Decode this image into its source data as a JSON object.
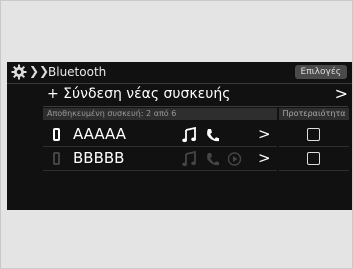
{
  "header": {
    "title": "Bluetooth",
    "options_label": "Επιλογές"
  },
  "add_device": {
    "label": "+ Σύνδεση νέας συσκευής"
  },
  "saved_list": {
    "label": "Αποθηκευμένη συσκευή: 2 από 6",
    "priority_header": "Προτεραιότητα"
  },
  "devices": [
    {
      "name": "AAAAA",
      "connected": true
    },
    {
      "name": "BBBBB",
      "connected": false
    }
  ],
  "colors": {
    "screen_bg": "#111111",
    "inactive_icon": "#454545"
  }
}
